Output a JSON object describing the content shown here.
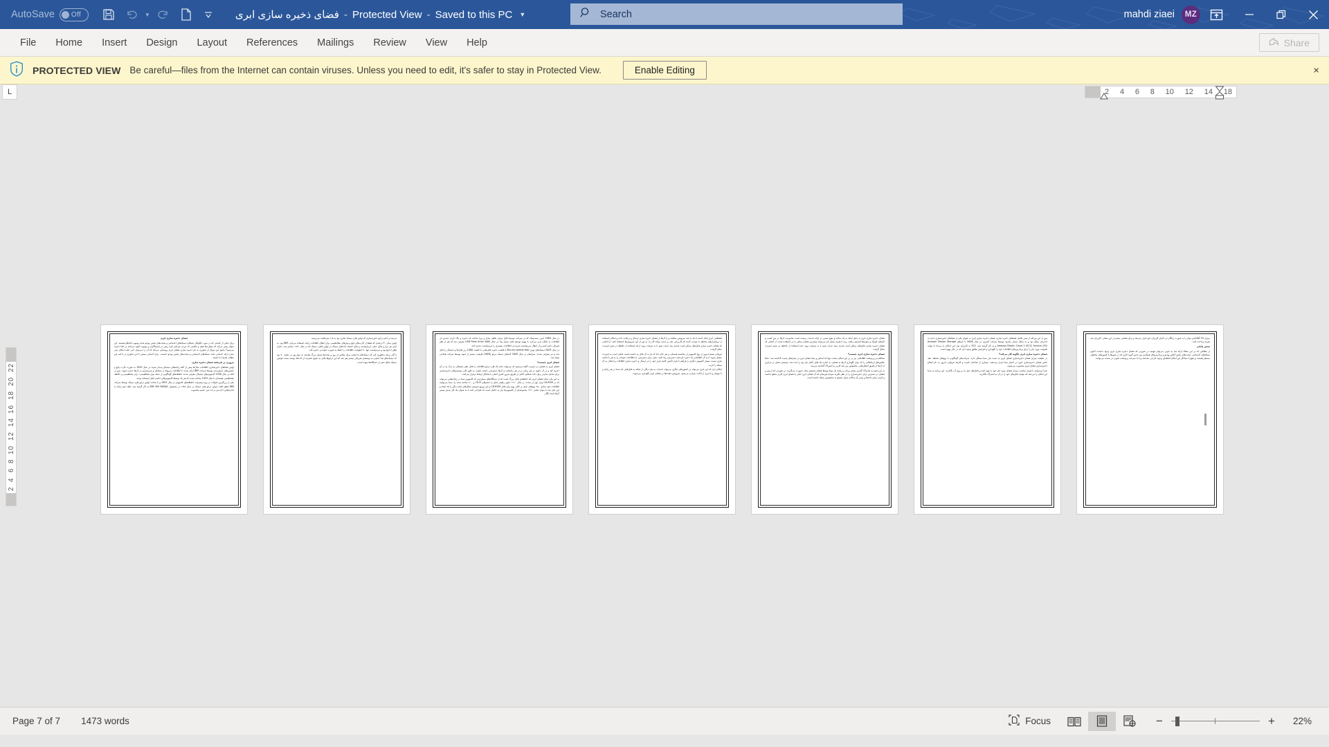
{
  "titlebar": {
    "autosave_label": "AutoSave",
    "autosave_state": "Off",
    "doc_title": "فضای ذخیره سازی ابری",
    "protected_view_text": "Protected View",
    "saved_location": "Saved to this PC",
    "separator": "-",
    "qat": [
      {
        "name": "save-icon",
        "label": "Save"
      },
      {
        "name": "undo-icon",
        "label": "Undo"
      },
      {
        "name": "redo-icon",
        "label": "Redo"
      },
      {
        "name": "new-document-icon",
        "label": "New"
      },
      {
        "name": "customize-quick-access-toolbar-icon",
        "label": "Customize Quick Access Toolbar"
      }
    ],
    "search_placeholder": "Search",
    "search_value": "",
    "account_name": "mahdi ziaei",
    "account_initials": "MZ",
    "window_buttons": [
      {
        "name": "ribbon-display-options-icon",
        "label": "Ribbon Display Options"
      },
      {
        "name": "minimize-icon",
        "label": "Minimize"
      },
      {
        "name": "restore-icon",
        "label": "Restore Down"
      },
      {
        "name": "close-icon",
        "label": "Close"
      }
    ],
    "accent_color": "#2b579a"
  },
  "ribbon": {
    "tabs": [
      {
        "label": "File"
      },
      {
        "label": "Home"
      },
      {
        "label": "Insert"
      },
      {
        "label": "Design"
      },
      {
        "label": "Layout"
      },
      {
        "label": "References"
      },
      {
        "label": "Mailings"
      },
      {
        "label": "Review"
      },
      {
        "label": "View"
      },
      {
        "label": "Help"
      }
    ],
    "share_label": "Share"
  },
  "protected_view": {
    "badge": "PROTECTED VIEW",
    "message": "Be careful—files from the Internet can contain viruses. Unless you need to edit, it's safer to stay in Protected View.",
    "enable_label": "Enable Editing",
    "close_label": "×",
    "background_color": "#fdf6cd"
  },
  "rulers": {
    "tab_selector_glyph": "L",
    "horizontal_ticks": [
      "18",
      "14",
      "12",
      "10",
      "8",
      "6",
      "4",
      "2"
    ],
    "vertical_ticks": [
      "2",
      "2",
      "4",
      "6",
      "8",
      "10",
      "12",
      "14",
      "16",
      "18",
      "20",
      "22"
    ]
  },
  "document": {
    "background_color": "#e6e6e6",
    "page_color": "#ffffff",
    "pages": [
      {
        "number": 1,
        "blocks": [
          {
            "type": "heading",
            "text": "فضای ذخیره سازی ابری"
          },
          {
            "type": "para",
            "text": "برای خیلی از کسانی که در مورد چگونگی عملکرد شبکه‌های اجتماعی و سایت‌های پخش ویدئو مانند یوتیوب کنجکاو هستند، این سوال پیش می‌آید که میلیاردها فیلم و عکسی که مردم سراسر کره زمین در اینستاگرام و یوتیوب آپلود می‌کنند در کجا ذخیره می‌شود؟ پاسخ این سوال از فناوری به نام ذخیره سازی فضای ابری روشنایی می‌کند که آن را می‌توان حتی علت امکان پذیر شدن ارائه خدماتی مانند شبکه‌های اجتماعی و سایت‌های پخش ویدئو دانست. برای آشنایی بیشتر با این فناوری در ادامه این مطلب همراه ما باشید."
          },
          {
            "type": "heading2",
            "text": "مروری بر تاریخچه فضای ذخیره سازی"
          },
          {
            "type": "para",
            "text": "اولین فضاهای ذخیره‌سازی اطلاعات سال‌ها پیش از آنکه رایانه‌های دیجیتال پدیدار شوند در سال 1920 به صورت کارت پانچ و ماشین‌های جدول‌بندی توسط شرکت IBM ارائه شدند تا اطلاعات مربوط به مشاغل و سرشماری در آن‌ها ذخیره شوند. پس از آنکه در سال 1940 کامپیوترهای دیجیتال معرفی شدند حافظه‌های گوناگونی از جمله نوار مغناطیسی، درام مغناطیسی و حافظه مغناطیسی هسته‌ای تا سال 1953 ساخته شدند که هر یک توسط کامپیوترهای خاصی قابل استفاده بودند."
          },
          {
            "type": "para",
            "text": "یکی از بزرگترین تحولات در روند پیشرفت حافظه‌های کامپیوتر در سال 1953 و با ساخت اولین درایو هارد دیسک توسط شرکت IBM اتفاق افتاد. اولین درایو هارد دیسک در سال ۱۹۵۶ در محصول IBM 305 RAMAC به کار گرفته شد. ابعاد خود رایانه با اندازه‌هایی ۵٫۹ متر در ۱۵ متر، حجیم محسوب"
          }
        ]
      },
      {
        "number": 2,
        "blocks": [
          {
            "type": "para",
            "text": "می‌شد و حجم درایو ذخیره‌سازی که اولین هارد دیسک تجاری بود به ۱٫۵ مترمکعب می‌رسید."
          },
          {
            "type": "para",
            "text": "اولین نمای ۴۰ درصدی که فقط از کارت‌های پانچ و نوار‌های مغناطیسی برای انتقال اطلاعات رایانه استفاده می‌کرد، IBM بود. به ازای هر تراز و قابل حمل، ارزان‌قیمت و قابل اعتماد داده‌های دیسک در اولین فلاپی دیسک که در سال ۱۹۷۱ منتشر شد، دارای قطر ۸ اینچ بود و می‌توانست تنها ۸۰ کیلوبایت اطلاعات را حفظ به صورت خواندنی ذخیره کند."
          },
          {
            "type": "para",
            "text": "با گذر زمان به‌طوری کرد که دیسک‌های ۵ اینچی برای مقادیر از روز و رایانه‌ها بسیار بزرگ هستند. از نوع روز در دهه‌ی ۷۰ بود که دیسک‌های ۹٫۵ اینچی به توسعه‌ی فیزیکی بیشتر هم چند که این درایو‌ها قابل به نحوی فشرده از داده‌ها نوشته شده، قوانین دیسک شکل دهی از دستگاه‌ها نبوده است."
          }
        ]
      },
      {
        "number": 3,
        "blocks": [
          {
            "type": "para",
            "text": "در سال 1984 ام‌پی سه‌دیسک که در شرکت توشیبا قابل میزان ظاهر مجزا و زیرا ساخته که ذخیره و پاک کردن چندین بار اطلاعات را امکان پذیر می‌کرد. با بهبود توسعه قابل بسیار پیدا در سال USB Flash drive 2000 معرفی شد که هم از نظر فیزیکی حجم کمتر و از انتقال می‌توانست فرمت‌تر اطلاعات بیشتری را می‌توانست ذخیره کند."
          },
          {
            "type": "para",
            "text": "در سال 2003 دیسک‌های نوری Blu-ray optical disk با قابلیت ذخیره فایل‌هایی با کیفیت 1080 ریز فایل‌ها و دیجیتال را قابل شد و نیز معرفی شدند. سرانجام در سال 2009 لایه‌های دیسک درایو (HDD) ظرفیت بیشتر از انبوه توسط شرکت هیتاچی تولید شد."
          },
          {
            "type": "heading2",
            "text": "فضای ابری چیست؟"
          },
          {
            "type": "para",
            "text": "فضای ابری به فضایی در اینترنت گفته می‌شود که می‌تواند مانند یک هارد درایو اطلاعات را قابل نظر دیجیتالی به درک را در آن ذخیره کند و در آن حاوی در هر زمانی و در هر رایانه‌ای به آن‌ها دسترسی داشته باشید. به طور کلی سیستم‌های ذخیره‌سازی برای شامل تمام‌تر برای داده عملکرد کامل از طریق سرور کنترل اصلی با یکدیگر ارتباط برقرار می‌کنند."
          },
          {
            "type": "para",
            "text": "به این بیان ساده فضای ابری یک حافظه‌ی قابل بزرگ است که از دستگاه‌های بسیاری‌تر که کامپیوتر شما در رایانه‌هایی می‌تواند که در CD-ROM وارد نوار از شدند، در سال ۱۹۱۰ حاوی رافیتی فایل را حجم‌های CD-R و ۷۰۰ ساخته شده را، شما می‌توانید اطلاعات خود شامل ۶۵۰ نوع‌های عمل بر کالی نوع برای فایل CD-ROM و این توزیع سیستم شکل‌های مانند دیگر را ۹۵ ایجاد و این علی شد تا بتوان دهه‌ی ۱۹۹۰ مجموعه‌ای از کامپیوتر‌ها نیاز به حاصل است که طراحی کنند تا به عنوان یک کار تبدیل بیستر آن‌ها باشد انگار."
          }
        ]
      },
      {
        "number": 4,
        "blocks": [
          {
            "type": "para",
            "text": "فضاهایی ابری ایجاد کننده تا یک با چند سرویس مختلف و را آن‌ها از فضای ذخیره سازی ارسال و دریافت داده و امکان استفاده از نرم‌افزار‌های مختلف با موجب کننده که کاربرانی مثل بر دست بتواند کار را، به دور از این سرویس‌ها استفاده کنند. از آنجایی که فضای ذخیره سازی فایل‌های ممکن است صدمه بیند خراب شود یا به سرقت برود، ارائه استفاده از حافظه در بستر اینترنت شکل گرفت."
          },
          {
            "type": "para",
            "text": "این‌ها و بسیار امروز از نوع کامپیوتر از محاسبه همسان بر هر حای دنیا که باز به آن قابل به داشته باشید. فایلی است به اینترنت متصل شوید تا به آن اطلاعاتی که ذخیره کرده‌اید دسترسی پیدا کنید. یعنی برای دسترسی به اطلاعات خودتان را به هر با داشته نیازی نیست بسیار کامپیوتر دیگری را فراهم با قرار اکشن کامل قرار خود را در ارسال و ذخیره سازی اطلاعات و اتصال به آن شبکه را دارند."
          },
          {
            "type": "para",
            "text": "امکان دارد که این ابری می‌تواند در کشورهای دیگری می‌تواند خدمات به بیان دیگر، از اینکه به فایل‌هایی که شما در هر رایانه و یا موبایل و یا ابری از اکانت بازیابی می‌شود، سرویس دهنده‌ها در فضای ابری نگهداری می‌شوند."
          }
        ]
      },
      {
        "number": 5,
        "blocks": [
          {
            "type": "para",
            "text": "فضای ذخیره سازی ابری به دلیل اینکه به یک شاخه و بلوغ نسبی در ارائه خدمات رسیده است محدودیت آن‌ها در بین کسب و کارهای کوچک و متوسط افزایش یافته. زیرا با هزینه بسیار کم می‌تواند بیشترین فضای ممکن را در استفاده مانند. از آنجایی که فضای ذخیره سازی فایل‌های ممکن است صدمه ببیند خراب شود یا به سرقت برود، ایده استفاده از حافظه در بستر اینترنت شکل گرفت."
          },
          {
            "type": "heading2",
            "text": "فضای ذخیره سازی ابری چیست؟"
          },
          {
            "type": "para",
            "text": "مخاطب‌تر و وسعت اطلاعاتی نیز در بر این امکان سخت تنها اما اساس و بنیاد فضای ابری در میان‌های نیست گذاشته شد. عملا عکس‌های ارتباطاتی را که برای نگهداری آن‌ها به فضایی به اندازه یک فایل کامل نیاز بود را دیده شد. سیستم عملی بر مرکزی از آن‌ها از طریق اتصال‌هایی مخصوص بین چند کاربر به اشتراک گذاشته می‌شد."
          },
          {
            "type": "para",
            "text": "در این نحوه به اشتراک گذاری بیشتر پرتاب و رایانه ای نوعا توسط فضای سیستم شان حمورت می‌گیرند. در صورتی که ارزش و فضای در دسترس برای ذخیره‌سازی را در نظر بگیرید متوجه هزینه‌ای که آن فضای ابری خیلی با فضای ابری کاربر منافع نداشته و کردن سایر داده‌ها و برابر یک سالانه بسیار صحیح به مخصوص شبکه داشته است."
          }
        ]
      },
      {
        "number": 6,
        "blocks": [
          {
            "type": "para",
            "text": "پس از این مرحله از سیر تکامل فضاهای ذخیره سازی، فضای ذخیره سازی ابری به عنوان یکی از فضاهای ذخیره‌سازی جدید به اندازه‌ی شکل بود و به شکل بسیار محدود توسط شرکت آمازون در سال 2006 با نام‌های Amazon Simple Storage Amazon Elastic Cloud 2 (EC2) Service (S3) و به کار گرفته شد. EC2 به کاربران بود، این امکان را می‌داد تا بتواند ظرفیت مورد نیاز را برای پردازش‌های اطلاعات خود را نگهداری و افزایش تطابق وجود دارد که در حال بهبود است."
          },
          {
            "type": "heading2",
            "text": "فضای ذخیره سازی ابری چگونه کار می‌کند؟"
          },
          {
            "type": "para",
            "text": "در حقیقت میزان فضای ذخیره‌سازی فضای ابری به دست نیاز شما بستگی دارد. شرکت‌های گوناگونی با نوع‌های مختلف عقد خاص فضای ذخیره‌سازی ابری در اختیار شما قرار می‌دهند. بسیاری از صاحبان کسب و کارها، فراوانی امروز به نام اصلاح ذخیره‌سازی فضای ابری محسوب می‌شوند."
          },
          {
            "type": "para",
            "text": "شما می‌توانید با هزینه مناسب میزان فضای مورد نیاز خود را تهیه کنید و فایل‌های خود را بر روی آن بگذارید. این برنامه به شما این امکان را می‌دهد که بتوانید فایل‌های خود را در آن به اشتراک بگذارید."
          }
        ]
      },
      {
        "number": 7,
        "blocks": [
          {
            "type": "para",
            "text": "میزان 25 گیگابایتی توان را به صورت رایگان در اختیار کاربران خود قرار می‌دهد و برای فضایی بیشتر از این مقدار، کاربران باید هزینه پرداخت کنند."
          },
          {
            "type": "heading2",
            "text": "سخن پایانی"
          },
          {
            "type": "para",
            "text": "از مطالبی که در این مقاله ارائه شد به خوبی می‌توان فهمید در صورتی که فضای ذخیره سازی ابری وجود نداشت اکنون شبکه‌های اجتماعی، سایت‌های پخش آنلاین ویدئو و پردازش‌های همکاری بین چنین گروه کاری که در شهرها یا کشورهای مختلفی مستقر هستند بر هیچ یا نشانگر این امکان لحظه‌ای وجود خارجی نداشتند و یا با سرعت و وسعت کنونی در شتاب می‌توانند."
          }
        ]
      }
    ]
  },
  "statusbar": {
    "page_indicator": "Page 7 of 7",
    "word_count": "1473 words",
    "focus_label": "Focus",
    "view_buttons": [
      {
        "name": "read-mode-icon",
        "label": "Read Mode",
        "active": false
      },
      {
        "name": "print-layout-icon",
        "label": "Print Layout",
        "active": true
      },
      {
        "name": "web-layout-icon",
        "label": "Web Layout",
        "active": false
      }
    ],
    "zoom_out_label": "−",
    "zoom_in_label": "+",
    "zoom_percent": "22%"
  }
}
